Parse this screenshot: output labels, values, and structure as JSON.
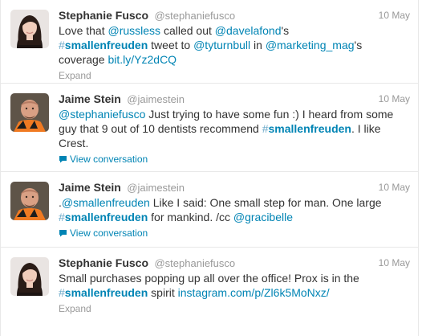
{
  "tweets": [
    {
      "name": "Stephanie Fusco",
      "username": "@stephaniefusco",
      "time": "10 May",
      "text": {
        "p1": "Love that ",
        "mention1": "@russless",
        "p2": " called out ",
        "mention2": "@davelafond",
        "p3": "'s ",
        "hashtag_hash": "#",
        "hashtag_word": "smallenfreuden",
        "p4": " tweet to ",
        "mention3": "@tyturnbull",
        "p5": " in ",
        "mention4": "@marketing_mag",
        "p6": "'s coverage ",
        "link": "bit.ly/Yz2dCQ"
      },
      "footer": "Expand",
      "avatar_icon": "woman-avatar"
    },
    {
      "name": "Jaime Stein",
      "username": "@jaimestein",
      "time": "10 May",
      "text": {
        "mention1": "@stephaniefusco",
        "p1": " Just trying to have some fun :) I heard from some guy that 9 out of 10 dentists recommend ",
        "hashtag_hash": "#",
        "hashtag_word": "smallenfreuden",
        "p2": ". I like Crest."
      },
      "footer": "View conversation",
      "avatar_icon": "man-avatar"
    },
    {
      "name": "Jaime Stein",
      "username": "@jaimestein",
      "time": "10 May",
      "text": {
        "p0": ".",
        "mention1": "@smallenfreuden",
        "p1": " Like I said: One small step for man. One large ",
        "hashtag_hash": "#",
        "hashtag_word": "smallenfreuden",
        "p2": " for mankind. /cc ",
        "mention2": "@gracibelle"
      },
      "footer": "View conversation",
      "avatar_icon": "man-avatar"
    },
    {
      "name": "Stephanie Fusco",
      "username": "@stephaniefusco",
      "time": "10 May",
      "text": {
        "p1": "Small purchases popping up all over the office! Prox is in the ",
        "hashtag_hash": "#",
        "hashtag_word": "smallenfreuden",
        "p2": " spirit ",
        "link": "instagram.com/p/Zl6k5MoNxz/"
      },
      "footer": "Expand",
      "avatar_icon": "woman-avatar"
    }
  ],
  "colors": {
    "link": "#0084b4",
    "muted": "#999999",
    "text": "#333333",
    "border": "#e8e8e8"
  }
}
